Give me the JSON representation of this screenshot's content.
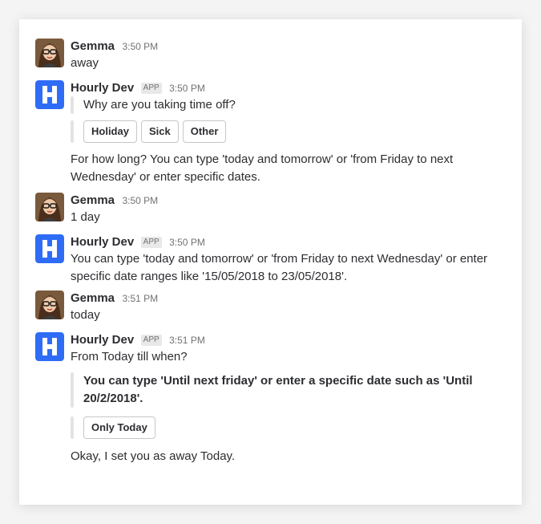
{
  "messages": [
    {
      "author": "Gemma",
      "time": "3:50 PM",
      "text": "away"
    },
    {
      "author": "Hourly Dev",
      "badge": "APP",
      "time": "3:50 PM",
      "attachment_text": "Why are you taking time off?",
      "buttons": [
        "Holiday",
        "Sick",
        "Other"
      ],
      "followup_text": "For how long? You can type 'today and tomorrow' or 'from Friday to next Wednesday' or enter specific dates."
    },
    {
      "author": "Gemma",
      "time": "3:50 PM",
      "text": "1 day"
    },
    {
      "author": "Hourly Dev",
      "badge": "APP",
      "time": "3:50 PM",
      "text": "You can type 'today and tomorrow' or 'from Friday to next Wednesday' or enter specific date ranges like '15/05/2018 to 23/05/2018'."
    },
    {
      "author": "Gemma",
      "time": "3:51 PM",
      "text": "today"
    },
    {
      "author": "Hourly Dev",
      "badge": "APP",
      "time": "3:51 PM",
      "text": "From Today till when?",
      "attachment_text": "You can type 'Until next friday' or enter a specific date such as 'Until 20/2/2018'.",
      "buttons": [
        "Only Today"
      ],
      "followup_text": "Okay, I set you as away Today."
    }
  ],
  "colors": {
    "bot_blue": "#2f6cf6",
    "badge_bg": "#e8e8e8",
    "attachment_bar": "#e3e3e3"
  },
  "icons": {
    "user_avatar": "woman-with-glasses-avatar",
    "bot_avatar": "hourly-h-logo-icon"
  }
}
